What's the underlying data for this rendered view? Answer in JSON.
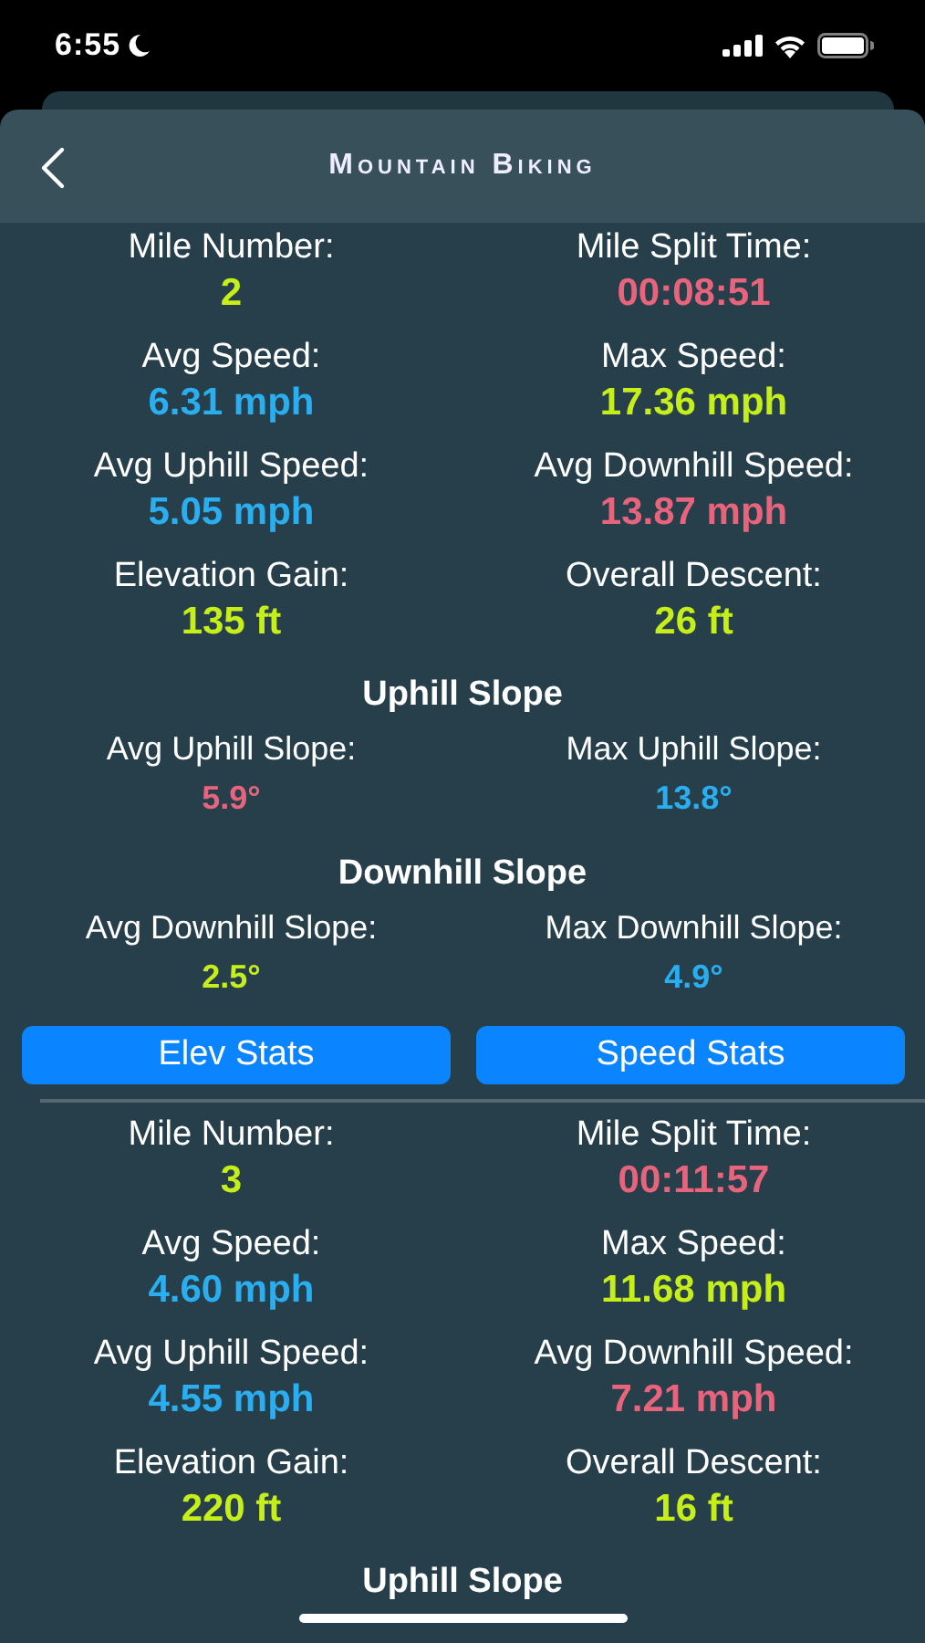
{
  "status_bar": {
    "time": "6:55"
  },
  "header": {
    "title": "Mountain Biking"
  },
  "miles": [
    {
      "stats": [
        [
          {
            "label": "Mile Number:",
            "value": "2",
            "color": "#c6ef1a"
          },
          {
            "label": "Mile Split Time:",
            "value": "00:08:51",
            "color": "#e8647c"
          }
        ],
        [
          {
            "label": "Avg Speed:",
            "value": "6.31 mph",
            "color": "#2aaef0"
          },
          {
            "label": "Max Speed:",
            "value": "17.36 mph",
            "color": "#c6ef1a"
          }
        ],
        [
          {
            "label": "Avg Uphill Speed:",
            "value": "5.05 mph",
            "color": "#2aaef0"
          },
          {
            "label": "Avg Downhill Speed:",
            "value": "13.87 mph",
            "color": "#e8647c"
          }
        ],
        [
          {
            "label": "Elevation Gain:",
            "value": "135 ft",
            "color": "#c6ef1a"
          },
          {
            "label": "Overall Descent:",
            "value": "26 ft",
            "color": "#c6ef1a"
          }
        ]
      ],
      "sections": [
        {
          "title": "Uphill Slope",
          "stats": [
            {
              "label": "Avg Uphill Slope:",
              "value": "5.9°",
              "color": "#e8647c"
            },
            {
              "label": "Max Uphill Slope:",
              "value": "13.8°",
              "color": "#2aaef0"
            }
          ]
        },
        {
          "title": "Downhill Slope",
          "stats": [
            {
              "label": "Avg Downhill Slope:",
              "value": "2.5°",
              "color": "#c6ef1a"
            },
            {
              "label": "Max Downhill Slope:",
              "value": "4.9°",
              "color": "#2aaef0"
            }
          ]
        }
      ],
      "buttons": [
        "Elev Stats",
        "Speed Stats"
      ]
    },
    {
      "stats": [
        [
          {
            "label": "Mile Number:",
            "value": "3",
            "color": "#c6ef1a"
          },
          {
            "label": "Mile Split Time:",
            "value": "00:11:57",
            "color": "#e8647c"
          }
        ],
        [
          {
            "label": "Avg Speed:",
            "value": "4.60 mph",
            "color": "#2aaef0"
          },
          {
            "label": "Max Speed:",
            "value": "11.68 mph",
            "color": "#c6ef1a"
          }
        ],
        [
          {
            "label": "Avg Uphill Speed:",
            "value": "4.55 mph",
            "color": "#2aaef0"
          },
          {
            "label": "Avg Downhill Speed:",
            "value": "7.21 mph",
            "color": "#e8647c"
          }
        ],
        [
          {
            "label": "Elevation Gain:",
            "value": "220 ft",
            "color": "#c6ef1a"
          },
          {
            "label": "Overall Descent:",
            "value": "16 ft",
            "color": "#c6ef1a"
          }
        ]
      ],
      "sections": [
        {
          "title": "Uphill Slope"
        }
      ]
    }
  ]
}
